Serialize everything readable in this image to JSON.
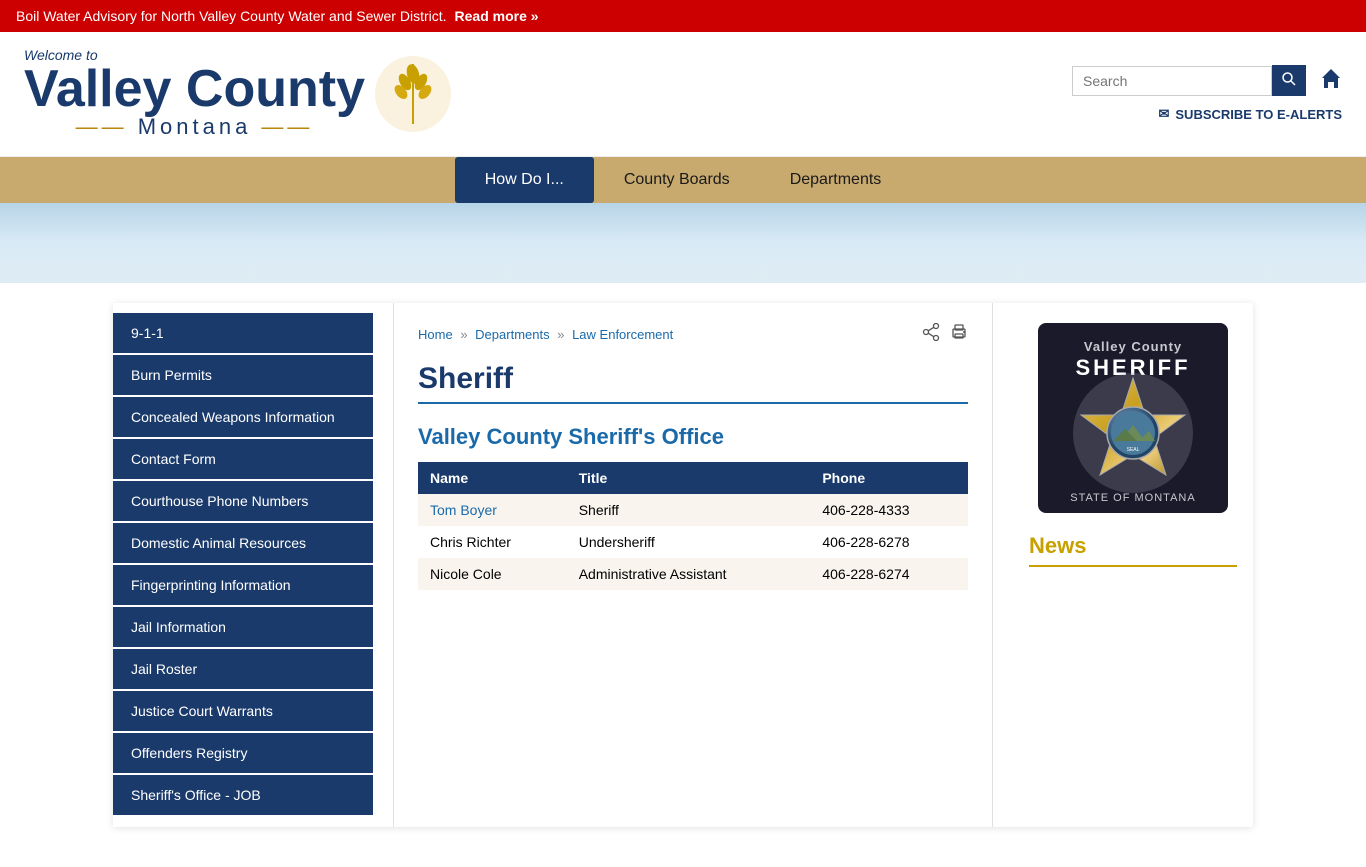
{
  "alert": {
    "text": "Boil Water Advisory for North Valley County Water and Sewer District.",
    "link_text": "Read more »"
  },
  "header": {
    "logo_welcome": "Welcome to",
    "logo_main": "Valley County",
    "logo_sub": "Montana",
    "search_placeholder": "Search",
    "subscribe_text": "SUBSCRIBE TO E-ALERTS"
  },
  "nav": {
    "items": [
      {
        "label": "How Do I...",
        "active": true
      },
      {
        "label": "County Boards",
        "active": false
      },
      {
        "label": "Departments",
        "active": false
      }
    ]
  },
  "sidebar": {
    "items": [
      {
        "label": "9-1-1"
      },
      {
        "label": "Burn Permits"
      },
      {
        "label": "Concealed Weapons Information"
      },
      {
        "label": "Contact Form"
      },
      {
        "label": "Courthouse Phone Numbers"
      },
      {
        "label": "Domestic Animal Resources"
      },
      {
        "label": "Fingerprinting Information"
      },
      {
        "label": "Jail Information"
      },
      {
        "label": "Jail Roster"
      },
      {
        "label": "Justice Court Warrants"
      },
      {
        "label": "Offenders Registry"
      },
      {
        "label": "Sheriff's Office - JOB"
      }
    ]
  },
  "breadcrumb": {
    "home": "Home",
    "departments": "Departments",
    "law_enforcement": "Law Enforcement"
  },
  "page": {
    "title": "Sheriff",
    "section_title": "Valley County Sheriff's Office",
    "table": {
      "headers": [
        "Name",
        "Title",
        "Phone"
      ],
      "rows": [
        {
          "name": "Tom Boyer",
          "name_link": true,
          "title": "Sheriff",
          "phone": "406-228-4333"
        },
        {
          "name": "Chris Richter",
          "name_link": false,
          "title": "Undersheriff",
          "phone": "406-228-6278"
        },
        {
          "name": "Nicole Cole",
          "name_link": false,
          "title": "Administrative Assistant",
          "phone": "406-228-6274"
        }
      ]
    }
  },
  "right_panel": {
    "news_title": "News"
  },
  "icons": {
    "share": "⬡",
    "print": "🖨",
    "home": "⌂",
    "search": "🔍",
    "mail": "✉"
  }
}
